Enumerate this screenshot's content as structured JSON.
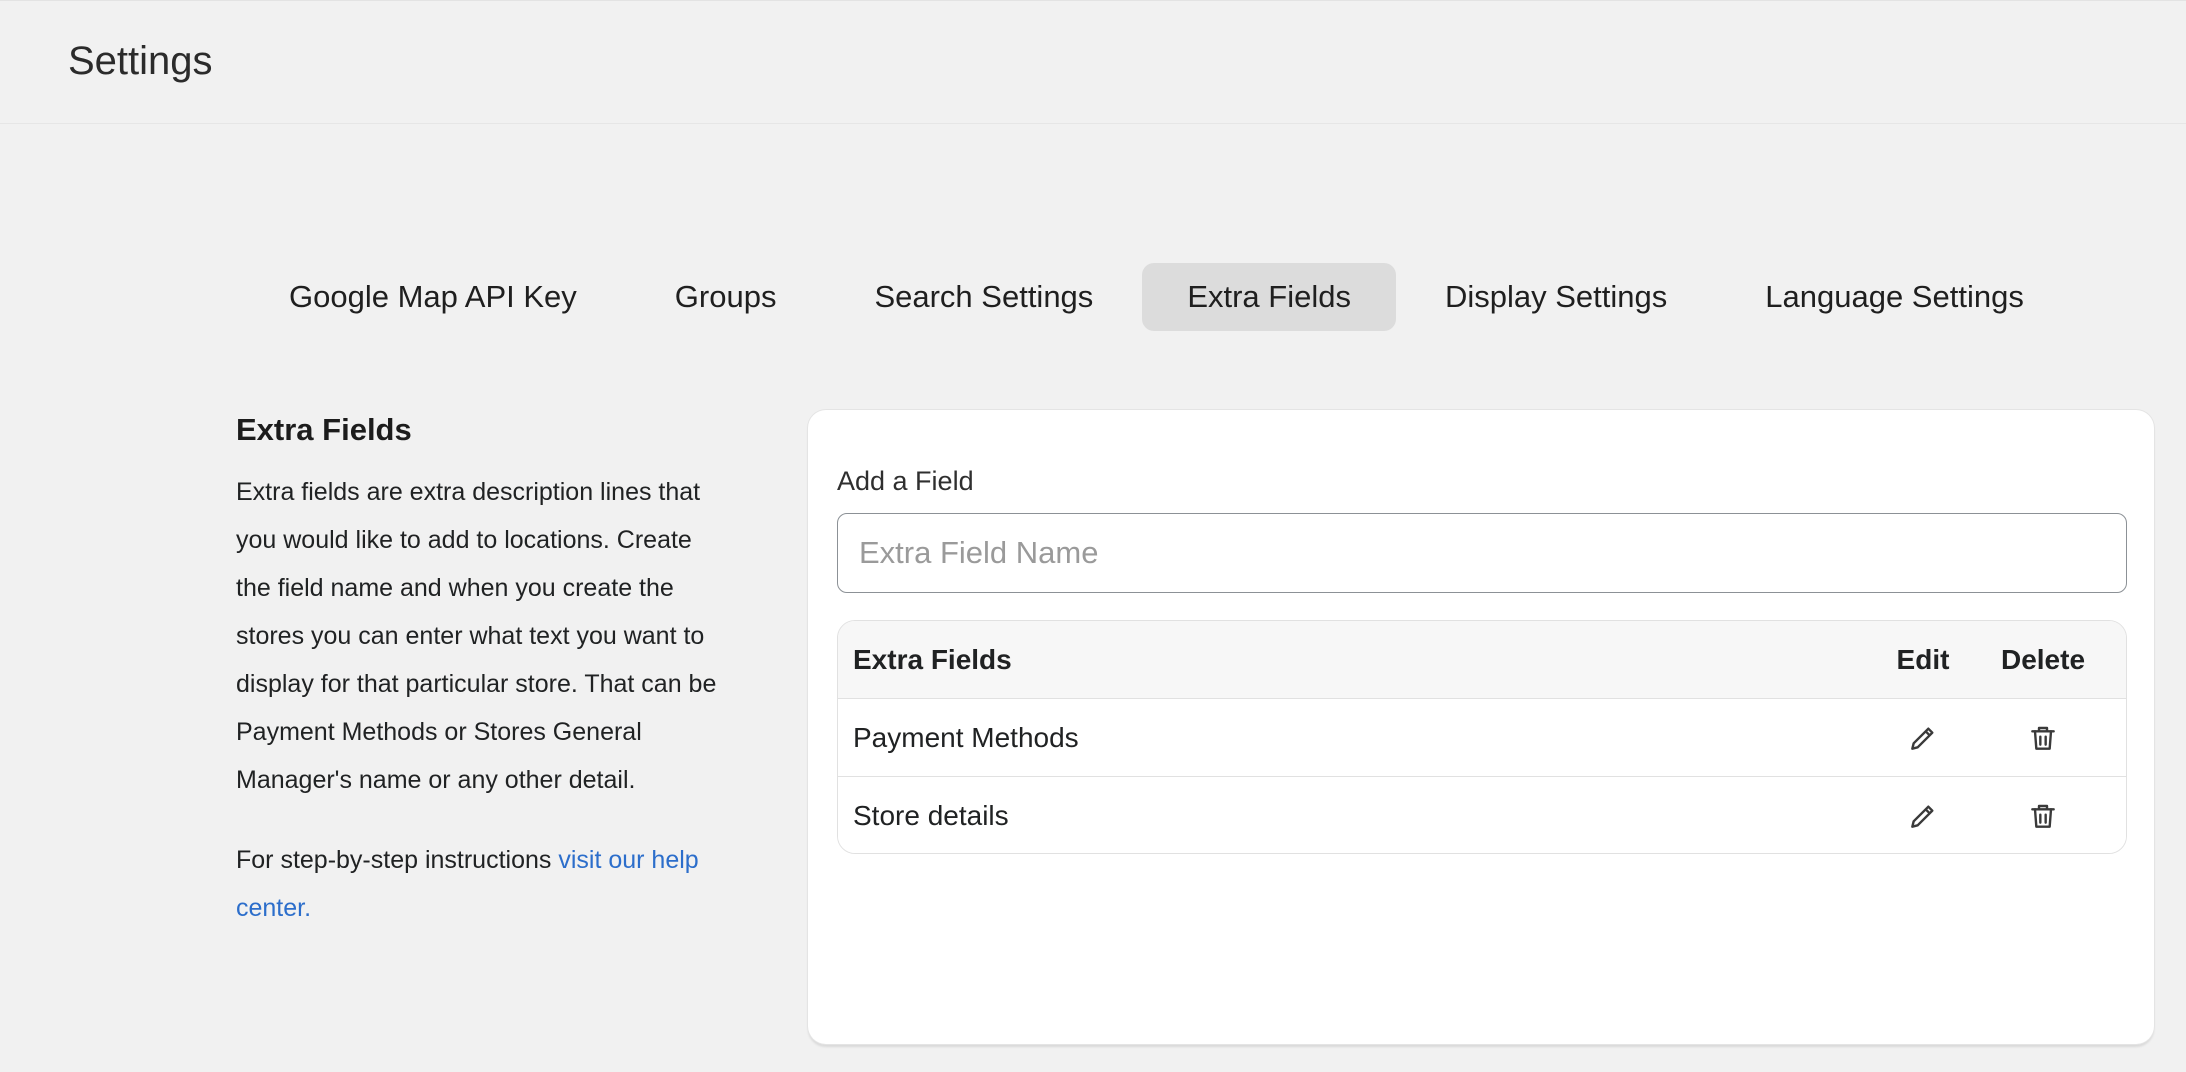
{
  "header": {
    "title": "Settings"
  },
  "tabs": [
    {
      "label": "Google Map API Key",
      "active": false
    },
    {
      "label": "Groups",
      "active": false
    },
    {
      "label": "Search Settings",
      "active": false
    },
    {
      "label": "Extra Fields",
      "active": true
    },
    {
      "label": "Display Settings",
      "active": false
    },
    {
      "label": "Language Settings",
      "active": false
    }
  ],
  "info": {
    "title": "Extra Fields",
    "description": "Extra fields are extra description lines that you would like to add to locations. Create the field name and when you create the stores you can enter what text you want to display for that particular store. That can be Payment Methods or Stores General Manager's name or any other detail.",
    "help_prefix": "For step-by-step instructions ",
    "help_link": "visit our help center."
  },
  "form": {
    "label": "Add a Field",
    "placeholder": "Extra Field Name",
    "value": ""
  },
  "table": {
    "headers": {
      "name": "Extra Fields",
      "edit": "Edit",
      "delete": "Delete"
    },
    "rows": [
      {
        "name": "Payment Methods"
      },
      {
        "name": "Store details"
      }
    ]
  },
  "icons": {
    "edit": "pencil-icon",
    "delete": "trash-icon"
  },
  "colors": {
    "link": "#2c6ecb",
    "active_tab_bg": "#dcdcdc",
    "page_bg": "#f1f1f1"
  }
}
